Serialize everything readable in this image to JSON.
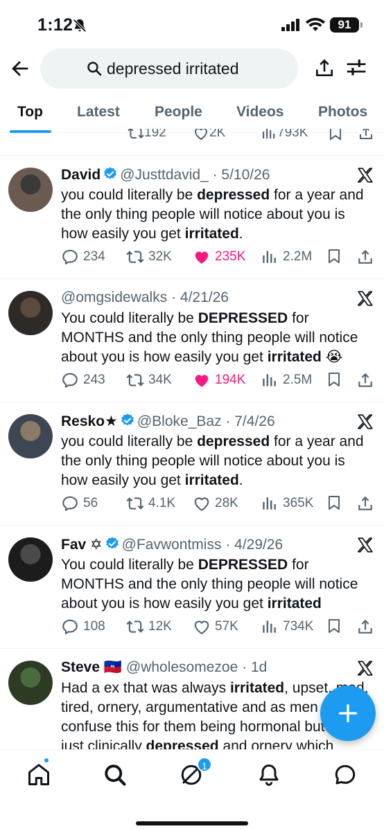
{
  "status": {
    "time": "1:12",
    "battery": "91"
  },
  "search": {
    "query": "depressed irritated"
  },
  "tabs": [
    "Top",
    "Latest",
    "People",
    "Videos",
    "Photos"
  ],
  "partial_row": {
    "retweets": "192",
    "likes": "2K",
    "views": "793K"
  },
  "tweets": [
    {
      "name": "David",
      "verified": true,
      "handle": "@Justtdavid_",
      "date": "· 5/10/26",
      "body_html": "you could literally be <b>depressed</b> for a year and the only thing people will notice about you is how easily you get <b>irritated</b>.",
      "replies": "234",
      "retweets": "32K",
      "likes": "235K",
      "liked": true,
      "views": "2.2M"
    },
    {
      "name": "",
      "verified": false,
      "handle": "@omgsidewalks",
      "date": "· 4/21/26",
      "body_html": "You could literally be <b>DEPRESSED</b> for MONTHS and the only thing people will notice about you is how easily you get <b>irritated</b> 😭",
      "replies": "243",
      "retweets": "34K",
      "likes": "194K",
      "liked": true,
      "views": "2.5M"
    },
    {
      "name": "Resko★",
      "verified": true,
      "handle": "@Bloke_Baz",
      "date": "· 7/4/26",
      "body_html": "you could literally be <b>depressed</b> for a year and the only thing people will notice about you is how easily you get <b>irritated</b>.",
      "replies": "56",
      "retweets": "4.1K",
      "likes": "28K",
      "liked": false,
      "views": "365K"
    },
    {
      "name": "Fav ✡",
      "verified": true,
      "handle": "@Favwontmiss",
      "date": "· 4/29/26",
      "body_html": "You could literally be <b>DEPRESSED</b> for MONTHS and the only thing people will notice about you is how easily you get <b>irritated</b>",
      "replies": "108",
      "retweets": "12K",
      "likes": "57K",
      "liked": false,
      "views": "734K"
    },
    {
      "name": "Steve 🇭🇹",
      "verified": false,
      "handle": "@wholesomezoe",
      "date": "· 1d",
      "body_html": "Had a ex that was always <b>irritated</b>, upset, mad, tired, ornery, argumentative and as men we confuse this for them being hormonal but it was just clinically <b>depressed</b> and ornery which",
      "replies": "",
      "retweets": "",
      "likes": "",
      "liked": false,
      "views": ""
    }
  ],
  "nav": {
    "messages_badge": "1"
  },
  "colors": {
    "accent": "#1d9bf0",
    "like": "#f91880",
    "muted": "#536471"
  }
}
